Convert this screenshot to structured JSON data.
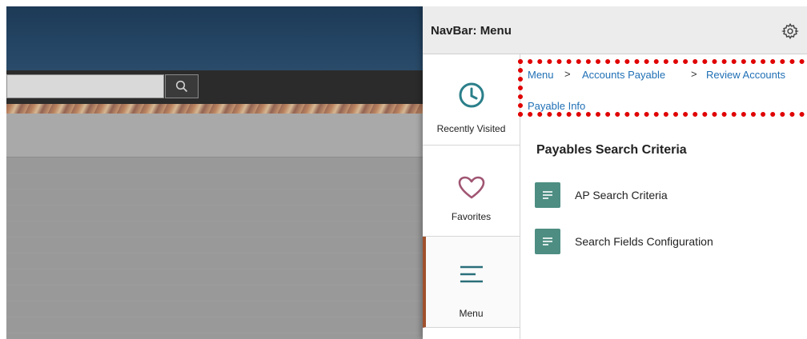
{
  "navbar": {
    "title": "NavBar: Menu",
    "icons": {
      "settings": "gear-icon"
    }
  },
  "sidebar": {
    "items": [
      {
        "label": "Recently Visited",
        "icon": "clock-icon",
        "active": false
      },
      {
        "label": "Favorites",
        "icon": "heart-icon",
        "active": false
      },
      {
        "label": "Menu",
        "icon": "menu-lines-icon",
        "active": true
      }
    ]
  },
  "breadcrumb": {
    "items": [
      "Menu",
      "Accounts Payable",
      "Review Accounts Payable Info"
    ],
    "line1_last": "Review Accounts",
    "line2": "Payable Info",
    "separator": ">"
  },
  "main": {
    "folder_title": "Payables Search Criteria",
    "items": [
      {
        "label": "AP Search Criteria",
        "icon": "document-icon"
      },
      {
        "label": "Search Fields Configuration",
        "icon": "document-icon"
      }
    ]
  },
  "colors": {
    "accent_active": "#a0522d",
    "link": "#1f6fb5",
    "tile": "#4d8d82",
    "highlight_box": "#e00000",
    "icon_teal": "#2a7f8a",
    "heart": "#a05572"
  }
}
